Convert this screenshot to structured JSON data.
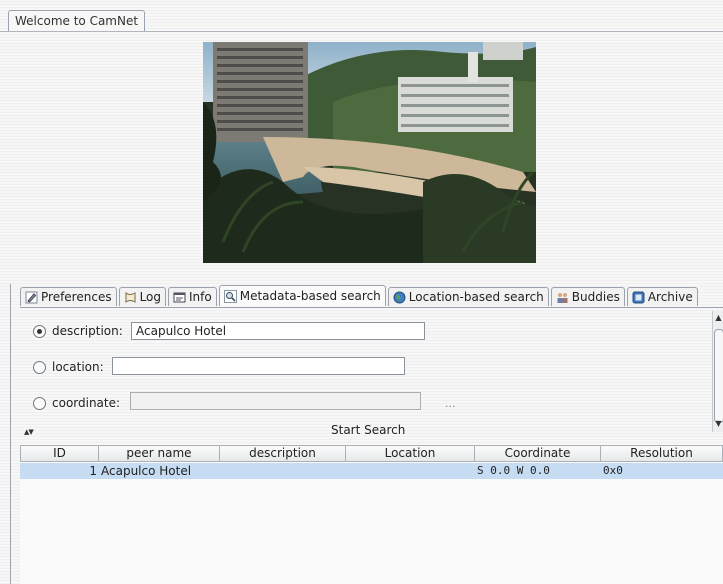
{
  "window_tab": {
    "label": "Welcome to CamNet"
  },
  "tabs": [
    {
      "label": "Preferences",
      "icon": "pencil-icon",
      "active": false
    },
    {
      "label": "Log",
      "icon": "scroll-icon",
      "active": false
    },
    {
      "label": "Info",
      "icon": "info-window-icon",
      "active": false
    },
    {
      "label": "Metadata-based search",
      "icon": "magnifier-icon",
      "active": true
    },
    {
      "label": "Location-based search",
      "icon": "globe-icon",
      "active": false
    },
    {
      "label": "Buddies",
      "icon": "people-icon",
      "active": false
    },
    {
      "label": "Archive",
      "icon": "archive-icon",
      "active": false
    }
  ],
  "search": {
    "description_label": "description:",
    "description_value": "Acapulco Hotel",
    "location_label": "location:",
    "location_value": "",
    "coordinate_label": "coordinate:",
    "coordinate_value": "",
    "coordinate_button": "...",
    "selected": "description",
    "start_label": "Start Search"
  },
  "table": {
    "columns": [
      "ID",
      "peer name",
      "description",
      "Location",
      "Coordinate",
      "Resolution"
    ],
    "rows": [
      {
        "id": "1",
        "peer_name": "Acapulco Hotel",
        "description": "",
        "location": "",
        "coordinate": "S 0.0 W 0.0",
        "resolution": "0x0"
      }
    ]
  },
  "colors": {
    "selection": "#c5dcf3",
    "border": "#9aa3ad"
  }
}
